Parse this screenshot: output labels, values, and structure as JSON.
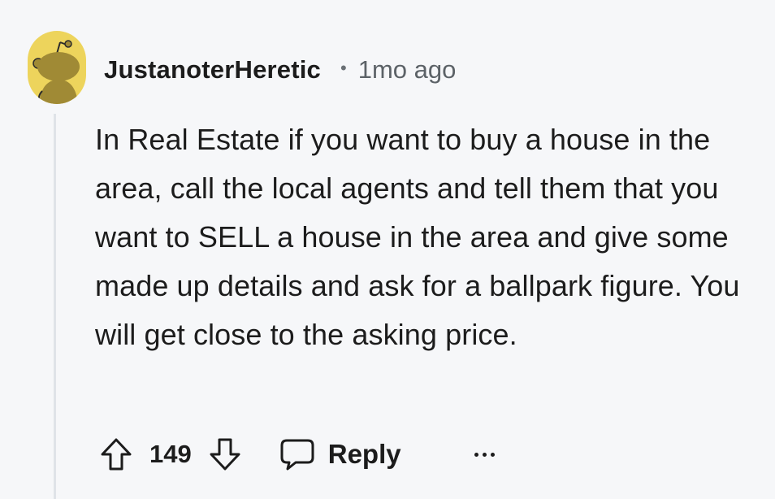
{
  "comment": {
    "author": "JustanoterHeretic",
    "separator": "•",
    "timestamp": "1mo ago",
    "body": "In Real Estate if you want to buy a house in the area, call the local agents and tell them that you want to SELL a house in the area and give some made up details and ask for a ballpark figure. You will get close to the asking price.",
    "score": "149",
    "reply_label": "Reply"
  },
  "icons": {
    "avatar": "snoo-avatar",
    "upvote": "arrow-up-icon",
    "downvote": "arrow-down-icon",
    "reply": "speech-bubble-icon",
    "more": "ellipsis-icon"
  },
  "colors": {
    "background": "#f6f7f9",
    "avatar_bg": "#edd45c",
    "thread_line": "#dfe3e8",
    "text": "#1c1c1c",
    "muted": "#5c6267"
  }
}
